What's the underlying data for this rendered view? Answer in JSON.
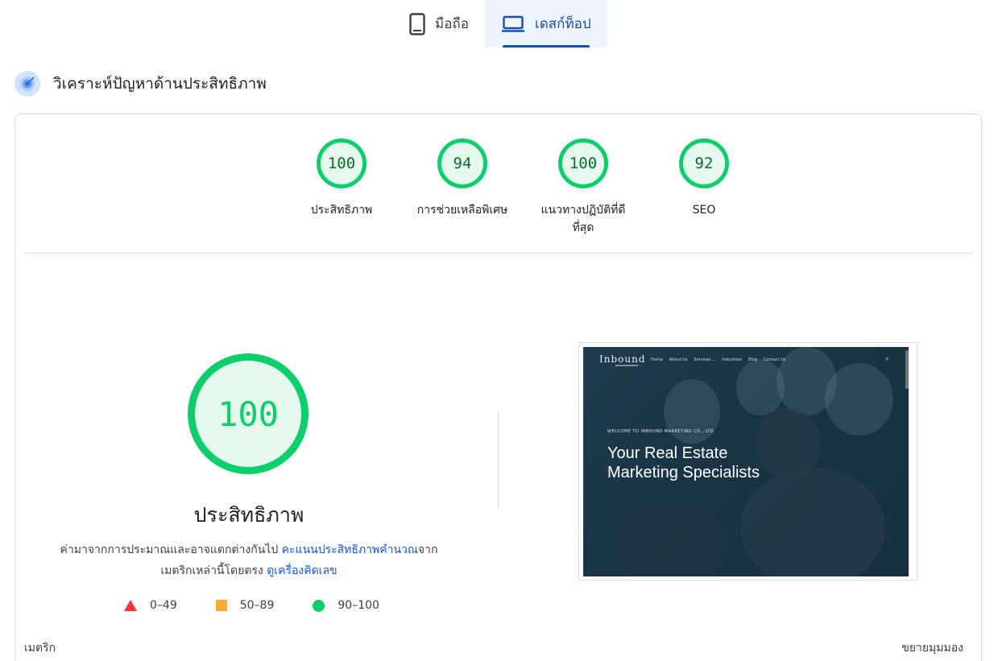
{
  "tabs": [
    {
      "label": "มือถือ",
      "icon": "phone-icon",
      "active": false
    },
    {
      "label": "เดสก์ท็อป",
      "icon": "laptop-icon",
      "active": true
    }
  ],
  "section": {
    "title": "วิเคราะห์ปัญหาด้านประสิทธิภาพ",
    "icon": "target-icon"
  },
  "gauges": [
    {
      "score": "100",
      "label": "ประสิทธิภาพ"
    },
    {
      "score": "94",
      "label": "การช่วยเหลือพิเศษ"
    },
    {
      "score": "100",
      "label": "แนวทางปฏิบัติที่ดีที่สุด"
    },
    {
      "score": "92",
      "label": "SEO"
    }
  ],
  "main": {
    "score": "100",
    "title": "ประสิทธิภาพ",
    "desc_part1": "ค่ามาจากการประมาณและอาจแตกต่างกันไป ",
    "desc_link1": "คะแนนประสิทธิภาพคำนวณ",
    "desc_part2": "จากเมตริกเหล่านี้โดยตรง ",
    "desc_link2": "ดูเครื่องคิดเลข"
  },
  "legend": [
    {
      "range": "0–49",
      "shape": "triangle",
      "color": "#ff3333"
    },
    {
      "range": "50–89",
      "shape": "square",
      "color": "#ffaa33"
    },
    {
      "range": "90–100",
      "shape": "circle",
      "color": "#0cce6b"
    }
  ],
  "thumbnail": {
    "logo": "Inbound",
    "nav": [
      "Home",
      "About Us",
      "Services ⌄",
      "Industries",
      "Blog",
      "Contact Us"
    ],
    "kicker": "WELCOME TO INBOUND MARKETING CO., LTD",
    "headline": "Your Real Estate Marketing Specialists"
  },
  "footer": {
    "left": "เมตริก",
    "right": "ขยายมุมมอง"
  },
  "colors": {
    "good": "#0cce6b",
    "accent": "#174ea6",
    "link": "#1a57d6"
  }
}
